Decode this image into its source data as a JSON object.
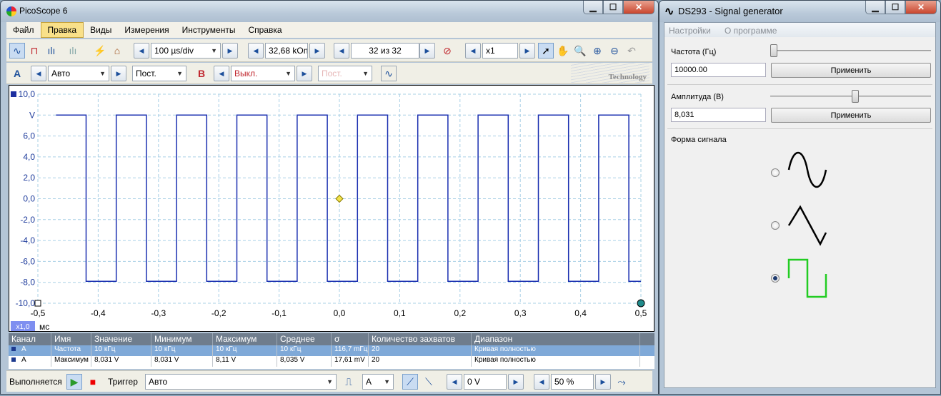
{
  "picoscope": {
    "title": "PicoScope 6",
    "menu": [
      "Файл",
      "Правка",
      "Виды",
      "Измерения",
      "Инструменты",
      "Справка"
    ],
    "toolbar1": {
      "timebase": "100 µs/div",
      "samples": "32,68 kOn",
      "capture": "32 из 32",
      "zoom": "x1"
    },
    "toolbar2": {
      "ch_a": "A",
      "ch_a_range": "Авто",
      "ch_a_coupling": "Пост.",
      "ch_b": "B",
      "ch_b_range": "Выкл.",
      "ch_b_coupling": "Пост.",
      "logo_text": "Technology"
    },
    "plot": {
      "y_ticks": [
        "10,0",
        "V",
        "6,0",
        "4,0",
        "2,0",
        "0,0",
        "-2,0",
        "-4,0",
        "-6,0",
        "-8,0",
        "-10,0"
      ],
      "x_ticks": [
        "-0,5",
        "-0,4",
        "-0,3",
        "-0,2",
        "-0,1",
        "0,0",
        "0,1",
        "0,2",
        "0,3",
        "0,4",
        "0,5"
      ],
      "x_unit": "мс",
      "zoom_badge": "x1,0"
    },
    "stats": {
      "headers": [
        "Канал",
        "Имя",
        "Значение",
        "Минимум",
        "Максимум",
        "Среднее",
        "σ",
        "Количество захватов",
        "Диапазон"
      ],
      "rows": [
        [
          "A",
          "Частота",
          "10 кГц",
          "10 кГц",
          "10 кГц",
          "10 кГц",
          "116,7 mГц",
          "20",
          "Кривая полностью"
        ],
        [
          "A",
          "Максимум",
          "8,031 V",
          "8,031 V",
          "8,11 V",
          "8,035 V",
          "17,61 mV",
          "20",
          "Кривая полностью"
        ]
      ]
    },
    "status": {
      "running": "Выполняется",
      "trigger_label": "Триггер",
      "trigger_mode": "Авто",
      "trigger_channel": "A",
      "trigger_level": "0 V",
      "pretrigger": "50 %"
    }
  },
  "chart_data": {
    "type": "line",
    "xlabel": "мс",
    "ylabel": "V",
    "xlim": [
      -0.5,
      0.5
    ],
    "ylim": [
      -10,
      10
    ],
    "series": [
      {
        "color": "#1a2fb0",
        "waveform": "square",
        "frequency_khz": 10,
        "high": 8.0,
        "low": -7.9
      }
    ]
  },
  "siggen": {
    "title": "DS293 - Signal generator",
    "menu": [
      "Настройки",
      "О программе"
    ],
    "freq_label": "Частота (Гц)",
    "freq_value": "10000.00",
    "freq_apply": "Применить",
    "amp_label": "Амплитуда (В)",
    "amp_value": "8,031",
    "amp_apply": "Применить",
    "waveform_label": "Форма сигнала",
    "selected_waveform": "square"
  }
}
